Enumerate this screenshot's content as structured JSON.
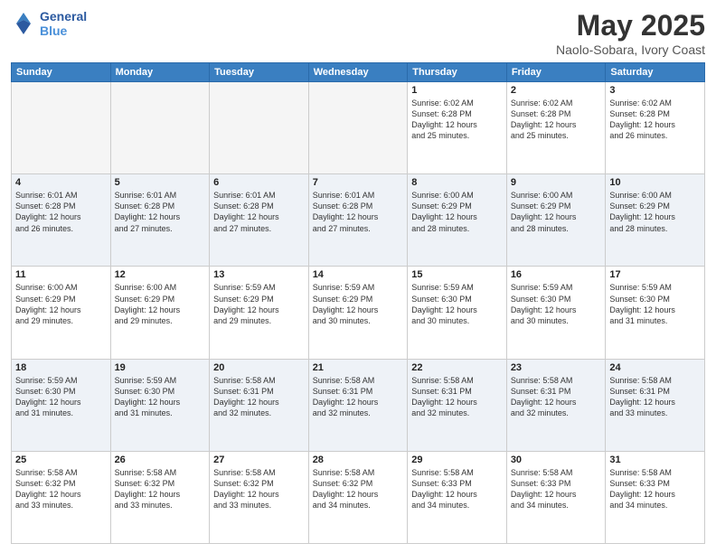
{
  "header": {
    "logo_line1": "General",
    "logo_line2": "Blue",
    "title": "May 2025",
    "subtitle": "Naolo-Sobara, Ivory Coast"
  },
  "days_of_week": [
    "Sunday",
    "Monday",
    "Tuesday",
    "Wednesday",
    "Thursday",
    "Friday",
    "Saturday"
  ],
  "weeks": [
    [
      {
        "day": "",
        "info": ""
      },
      {
        "day": "",
        "info": ""
      },
      {
        "day": "",
        "info": ""
      },
      {
        "day": "",
        "info": ""
      },
      {
        "day": "1",
        "info": "Sunrise: 6:02 AM\nSunset: 6:28 PM\nDaylight: 12 hours\nand 25 minutes."
      },
      {
        "day": "2",
        "info": "Sunrise: 6:02 AM\nSunset: 6:28 PM\nDaylight: 12 hours\nand 25 minutes."
      },
      {
        "day": "3",
        "info": "Sunrise: 6:02 AM\nSunset: 6:28 PM\nDaylight: 12 hours\nand 26 minutes."
      }
    ],
    [
      {
        "day": "4",
        "info": "Sunrise: 6:01 AM\nSunset: 6:28 PM\nDaylight: 12 hours\nand 26 minutes."
      },
      {
        "day": "5",
        "info": "Sunrise: 6:01 AM\nSunset: 6:28 PM\nDaylight: 12 hours\nand 27 minutes."
      },
      {
        "day": "6",
        "info": "Sunrise: 6:01 AM\nSunset: 6:28 PM\nDaylight: 12 hours\nand 27 minutes."
      },
      {
        "day": "7",
        "info": "Sunrise: 6:01 AM\nSunset: 6:28 PM\nDaylight: 12 hours\nand 27 minutes."
      },
      {
        "day": "8",
        "info": "Sunrise: 6:00 AM\nSunset: 6:29 PM\nDaylight: 12 hours\nand 28 minutes."
      },
      {
        "day": "9",
        "info": "Sunrise: 6:00 AM\nSunset: 6:29 PM\nDaylight: 12 hours\nand 28 minutes."
      },
      {
        "day": "10",
        "info": "Sunrise: 6:00 AM\nSunset: 6:29 PM\nDaylight: 12 hours\nand 28 minutes."
      }
    ],
    [
      {
        "day": "11",
        "info": "Sunrise: 6:00 AM\nSunset: 6:29 PM\nDaylight: 12 hours\nand 29 minutes."
      },
      {
        "day": "12",
        "info": "Sunrise: 6:00 AM\nSunset: 6:29 PM\nDaylight: 12 hours\nand 29 minutes."
      },
      {
        "day": "13",
        "info": "Sunrise: 5:59 AM\nSunset: 6:29 PM\nDaylight: 12 hours\nand 29 minutes."
      },
      {
        "day": "14",
        "info": "Sunrise: 5:59 AM\nSunset: 6:29 PM\nDaylight: 12 hours\nand 30 minutes."
      },
      {
        "day": "15",
        "info": "Sunrise: 5:59 AM\nSunset: 6:30 PM\nDaylight: 12 hours\nand 30 minutes."
      },
      {
        "day": "16",
        "info": "Sunrise: 5:59 AM\nSunset: 6:30 PM\nDaylight: 12 hours\nand 30 minutes."
      },
      {
        "day": "17",
        "info": "Sunrise: 5:59 AM\nSunset: 6:30 PM\nDaylight: 12 hours\nand 31 minutes."
      }
    ],
    [
      {
        "day": "18",
        "info": "Sunrise: 5:59 AM\nSunset: 6:30 PM\nDaylight: 12 hours\nand 31 minutes."
      },
      {
        "day": "19",
        "info": "Sunrise: 5:59 AM\nSunset: 6:30 PM\nDaylight: 12 hours\nand 31 minutes."
      },
      {
        "day": "20",
        "info": "Sunrise: 5:58 AM\nSunset: 6:31 PM\nDaylight: 12 hours\nand 32 minutes."
      },
      {
        "day": "21",
        "info": "Sunrise: 5:58 AM\nSunset: 6:31 PM\nDaylight: 12 hours\nand 32 minutes."
      },
      {
        "day": "22",
        "info": "Sunrise: 5:58 AM\nSunset: 6:31 PM\nDaylight: 12 hours\nand 32 minutes."
      },
      {
        "day": "23",
        "info": "Sunrise: 5:58 AM\nSunset: 6:31 PM\nDaylight: 12 hours\nand 32 minutes."
      },
      {
        "day": "24",
        "info": "Sunrise: 5:58 AM\nSunset: 6:31 PM\nDaylight: 12 hours\nand 33 minutes."
      }
    ],
    [
      {
        "day": "25",
        "info": "Sunrise: 5:58 AM\nSunset: 6:32 PM\nDaylight: 12 hours\nand 33 minutes."
      },
      {
        "day": "26",
        "info": "Sunrise: 5:58 AM\nSunset: 6:32 PM\nDaylight: 12 hours\nand 33 minutes."
      },
      {
        "day": "27",
        "info": "Sunrise: 5:58 AM\nSunset: 6:32 PM\nDaylight: 12 hours\nand 33 minutes."
      },
      {
        "day": "28",
        "info": "Sunrise: 5:58 AM\nSunset: 6:32 PM\nDaylight: 12 hours\nand 34 minutes."
      },
      {
        "day": "29",
        "info": "Sunrise: 5:58 AM\nSunset: 6:33 PM\nDaylight: 12 hours\nand 34 minutes."
      },
      {
        "day": "30",
        "info": "Sunrise: 5:58 AM\nSunset: 6:33 PM\nDaylight: 12 hours\nand 34 minutes."
      },
      {
        "day": "31",
        "info": "Sunrise: 5:58 AM\nSunset: 6:33 PM\nDaylight: 12 hours\nand 34 minutes."
      }
    ]
  ]
}
